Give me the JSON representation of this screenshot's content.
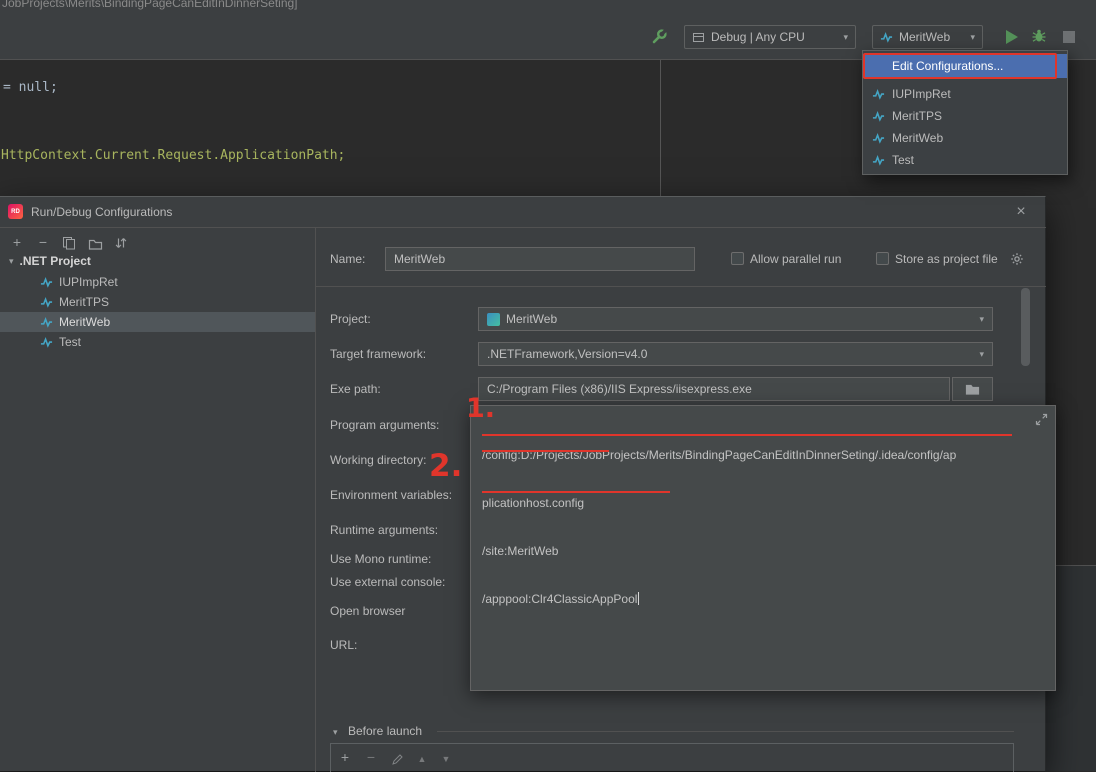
{
  "titlebar": {
    "path": "JobProjects\\Merits\\BindingPageCanEditInDinnerSeting]"
  },
  "toolbar": {
    "solution_config": "Debug | Any CPU",
    "run_config": "MeritWeb"
  },
  "config_menu": {
    "items": [
      "Edit Configurations...",
      "IUPImpRet",
      "MeritTPS",
      "MeritWeb",
      "Test"
    ]
  },
  "editor": {
    "line1": "= null;",
    "line2": "HttpContext.Current.Request.ApplicationPath;"
  },
  "dialog": {
    "title": "Run/Debug Configurations",
    "tree_root": ".NET Project",
    "tree_items": [
      "IUPImpRet",
      "MeritTPS",
      "MeritWeb",
      "Test"
    ],
    "name_label": "Name:",
    "name_value": "MeritWeb",
    "allow_parallel_label": "Allow parallel run",
    "store_project_label": "Store as project file",
    "project_label": "Project:",
    "project_value": "MeritWeb",
    "target_framework_label": "Target framework:",
    "target_framework_value": ".NETFramework,Version=v4.0",
    "exe_path_label": "Exe path:",
    "exe_path_value": "C:/Program Files (x86)/IIS Express/iisexpress.exe",
    "program_arguments_label": "Program arguments:",
    "working_directory_label": "Working directory:",
    "environment_variables_label": "Environment variables:",
    "runtime_arguments_label": "Runtime arguments:",
    "use_mono_label": "Use Mono runtime:",
    "use_external_console_label": "Use external console:",
    "open_browser_label": "Open browser",
    "url_label": "URL:",
    "args_line1": "/config:D:/Projects/JobProjects/Merits/BindingPageCanEditInDinnerSeting/.idea/config/ap",
    "args_line2": "plicationhost.config",
    "args_line3": "/site:MeritWeb",
    "args_line4": "/apppool:Clr4ClassicAppPool",
    "before_launch_label": "Before launch"
  },
  "annotations": {
    "step1": "1.",
    "step2": "2."
  }
}
